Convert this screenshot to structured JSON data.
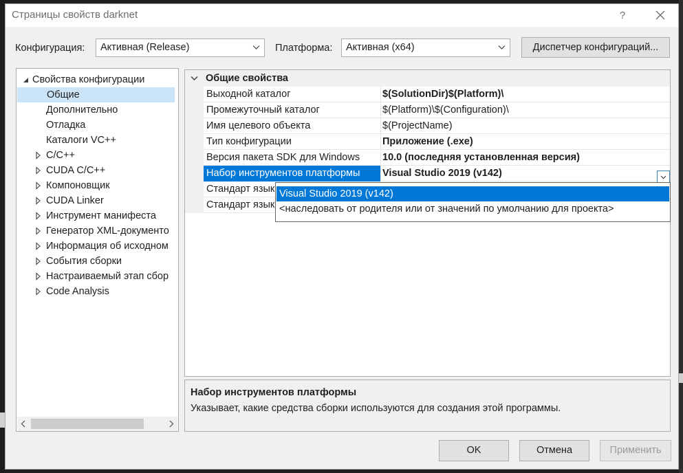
{
  "window": {
    "title": "Страницы свойств darknet",
    "help_label": "?"
  },
  "toolbar": {
    "configuration_label": "Конфигурация:",
    "configuration_value": "Активная (Release)",
    "platform_label": "Платформа:",
    "platform_value": "Активная (x64)",
    "config_manager_label": "Диспетчер конфигураций..."
  },
  "tree": {
    "root_label": "Свойства конфигурации",
    "items": [
      {
        "label": "Общие",
        "selected": true,
        "expandable": false
      },
      {
        "label": "Дополнительно",
        "expandable": false
      },
      {
        "label": "Отладка",
        "expandable": false
      },
      {
        "label": "Каталоги VC++",
        "expandable": false
      },
      {
        "label": "C/C++",
        "expandable": true
      },
      {
        "label": "CUDA C/C++",
        "expandable": true
      },
      {
        "label": "Компоновщик",
        "expandable": true
      },
      {
        "label": "CUDA Linker",
        "expandable": true
      },
      {
        "label": "Инструмент манифеста",
        "expandable": true
      },
      {
        "label": "Генератор XML-документо",
        "expandable": true
      },
      {
        "label": "Информация об исходном",
        "expandable": true
      },
      {
        "label": "События сборки",
        "expandable": true
      },
      {
        "label": "Настраиваемый этап сбор",
        "expandable": true
      },
      {
        "label": "Code Analysis",
        "expandable": true
      }
    ]
  },
  "grid": {
    "section_title": "Общие свойства",
    "rows": [
      {
        "name": "Выходной каталог",
        "value": "$(SolutionDir)$(Platform)\\",
        "bold": true
      },
      {
        "name": "Промежуточный каталог",
        "value": "$(Platform)\\$(Configuration)\\",
        "bold": false
      },
      {
        "name": "Имя целевого объекта",
        "value": "$(ProjectName)",
        "bold": false
      },
      {
        "name": "Тип конфигурации",
        "value": "Приложение (.exe)",
        "bold": true
      },
      {
        "name": "Версия пакета SDK для Windows",
        "value": "10.0 (последняя установленная версия)",
        "bold": true
      },
      {
        "name": "Набор инструментов платформы",
        "value": "Visual Studio 2019 (v142)",
        "bold": true,
        "selected": true
      },
      {
        "name": "Стандарт языка C++",
        "value": "",
        "bold": false
      },
      {
        "name": "Стандарт языка C",
        "value": "",
        "bold": false
      }
    ]
  },
  "dropdown": {
    "options": [
      {
        "label": "Visual Studio 2019 (v142)",
        "selected": true
      },
      {
        "label": "<наследовать от родителя или от значений по умолчанию для проекта>",
        "selected": false
      }
    ]
  },
  "description": {
    "title": "Набор инструментов платформы",
    "text": "Указывает, какие средства сборки используются для создания этой программы."
  },
  "buttons": {
    "ok": "OK",
    "cancel": "Отмена",
    "apply": "Применить"
  },
  "colors": {
    "accent": "#0078d7",
    "tree_selection": "#cce4f7",
    "dialog_bg": "#f0f0f0"
  }
}
